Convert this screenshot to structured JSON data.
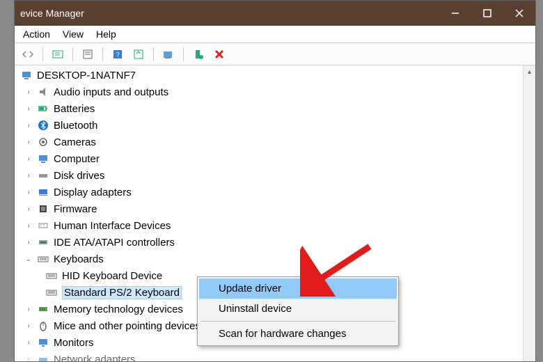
{
  "window": {
    "title": "evice Manager"
  },
  "menubar": {
    "action": "Action",
    "view": "View",
    "help": "Help"
  },
  "tree": {
    "root": "DESKTOP-1NATNF7",
    "items": [
      {
        "label": "Audio inputs and outputs",
        "icon": "audio-icon"
      },
      {
        "label": "Batteries",
        "icon": "battery-icon"
      },
      {
        "label": "Bluetooth",
        "icon": "bluetooth-icon"
      },
      {
        "label": "Cameras",
        "icon": "camera-icon"
      },
      {
        "label": "Computer",
        "icon": "computer-icon"
      },
      {
        "label": "Disk drives",
        "icon": "disk-icon"
      },
      {
        "label": "Display adapters",
        "icon": "display-icon"
      },
      {
        "label": "Firmware",
        "icon": "firmware-icon"
      },
      {
        "label": "Human Interface Devices",
        "icon": "hid-icon"
      },
      {
        "label": "IDE ATA/ATAPI controllers",
        "icon": "ide-icon"
      },
      {
        "label": "Keyboards",
        "icon": "keyboard-icon",
        "expanded": true
      },
      {
        "label": "Memory technology devices",
        "icon": "memory-icon"
      },
      {
        "label": "Mice and other pointing devices",
        "icon": "mouse-icon"
      },
      {
        "label": "Monitors",
        "icon": "monitor-icon"
      },
      {
        "label": "Network adapters",
        "icon": "network-icon"
      }
    ],
    "keyboards_children": [
      {
        "label": "HID Keyboard Device"
      },
      {
        "label": "Standard PS/2 Keyboard",
        "selected": true
      }
    ]
  },
  "context_menu": {
    "update": "Update driver",
    "uninstall": "Uninstall device",
    "scan": "Scan for hardware changes"
  },
  "colors": {
    "titlebar": "#5a4030",
    "highlight": "#91c9f7",
    "selection": "#cce8ff",
    "arrow": "#e21b1b"
  }
}
